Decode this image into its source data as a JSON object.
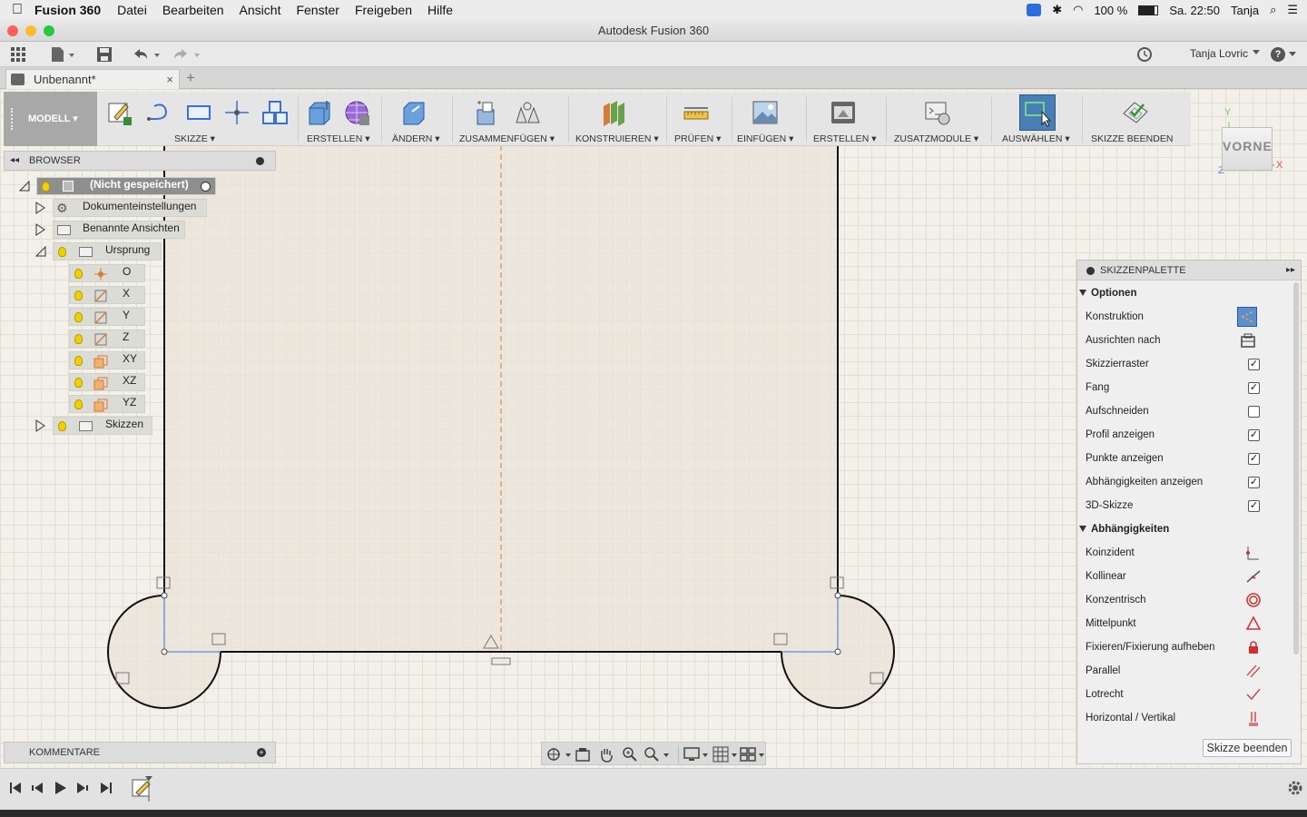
{
  "menubar": {
    "app_name": "Fusion 360",
    "items": [
      "Datei",
      "Bearbeiten",
      "Ansicht",
      "Fenster",
      "Freigeben",
      "Hilfe"
    ],
    "battery": "100 %",
    "clock": "Sa. 22:50",
    "user": "Tanja"
  },
  "window": {
    "title": "Autodesk Fusion 360"
  },
  "qab": {
    "user_name": "Tanja Lovric",
    "help": "?"
  },
  "document_tab": {
    "name": "Unbenannt*",
    "close": "×",
    "new_tab": "+"
  },
  "toolbar": {
    "workspace": "MODELL",
    "groups": {
      "skizze": "SKIZZE",
      "erstellen": "ERSTELLEN",
      "aendern": "ÄNDERN",
      "zusammenfuegen": "ZUSAMMENFÜGEN",
      "konstruieren": "KONSTRUIEREN",
      "pruefen": "PRÜFEN",
      "einfuegen": "EINFÜGEN",
      "erstellen2": "ERSTELLEN",
      "zusatzmodule": "ZUSATZMODULE",
      "auswaehlen": "AUSWÄHLEN",
      "skizze_beenden": "SKIZZE BEENDEN"
    }
  },
  "browser": {
    "title": "BROWSER",
    "root": "(Nicht gespeichert)",
    "items": {
      "doc_settings": "Dokumenteinstellungen",
      "named_views": "Benannte Ansichten",
      "origin": "Ursprung",
      "sketches": "Skizzen"
    },
    "origin_children": [
      "O",
      "X",
      "Y",
      "Z",
      "XY",
      "XZ",
      "YZ"
    ]
  },
  "comments": {
    "title": "KOMMENTARE"
  },
  "viewcube": {
    "face": "VORNE",
    "axis_x": "X",
    "axis_y": "Y",
    "axis_z": "Z"
  },
  "palette": {
    "title": "SKIZZENPALETTE",
    "options_header": "Optionen",
    "options": [
      {
        "label": "Konstruktion",
        "type": "icon",
        "icon": "construction-icon"
      },
      {
        "label": "Ausrichten nach",
        "type": "icon",
        "icon": "look-at-icon"
      },
      {
        "label": "Skizzierraster",
        "type": "check",
        "checked": true
      },
      {
        "label": "Fang",
        "type": "check",
        "checked": true
      },
      {
        "label": "Aufschneiden",
        "type": "check",
        "checked": false
      },
      {
        "label": "Profil anzeigen",
        "type": "check",
        "checked": true
      },
      {
        "label": "Punkte anzeigen",
        "type": "check",
        "checked": true
      },
      {
        "label": "Abhängigkeiten anzeigen",
        "type": "check",
        "checked": true
      },
      {
        "label": "3D-Skizze",
        "type": "check",
        "checked": true
      }
    ],
    "constraints_header": "Abhängigkeiten",
    "constraints": [
      {
        "label": "Koinzident",
        "icon": "coincident-icon"
      },
      {
        "label": "Kollinear",
        "icon": "collinear-icon"
      },
      {
        "label": "Konzentrisch",
        "icon": "concentric-icon"
      },
      {
        "label": "Mittelpunkt",
        "icon": "midpoint-icon"
      },
      {
        "label": "Fixieren/Fixierung aufheben",
        "icon": "fix-lock-icon"
      },
      {
        "label": "Parallel",
        "icon": "parallel-icon"
      },
      {
        "label": "Lotrecht",
        "icon": "perpendicular-icon"
      },
      {
        "label": "Horizontal / Vertikal",
        "icon": "horizontal-vertical-icon"
      }
    ],
    "finish_button": "Skizze beenden"
  },
  "colors": {
    "sketch_line": "#111111",
    "constraint_blue": "#3a6fd8",
    "centerline_orange": "#e07a2a",
    "accent_red": "#d23030",
    "selected_tool": "#4a7fb5"
  }
}
